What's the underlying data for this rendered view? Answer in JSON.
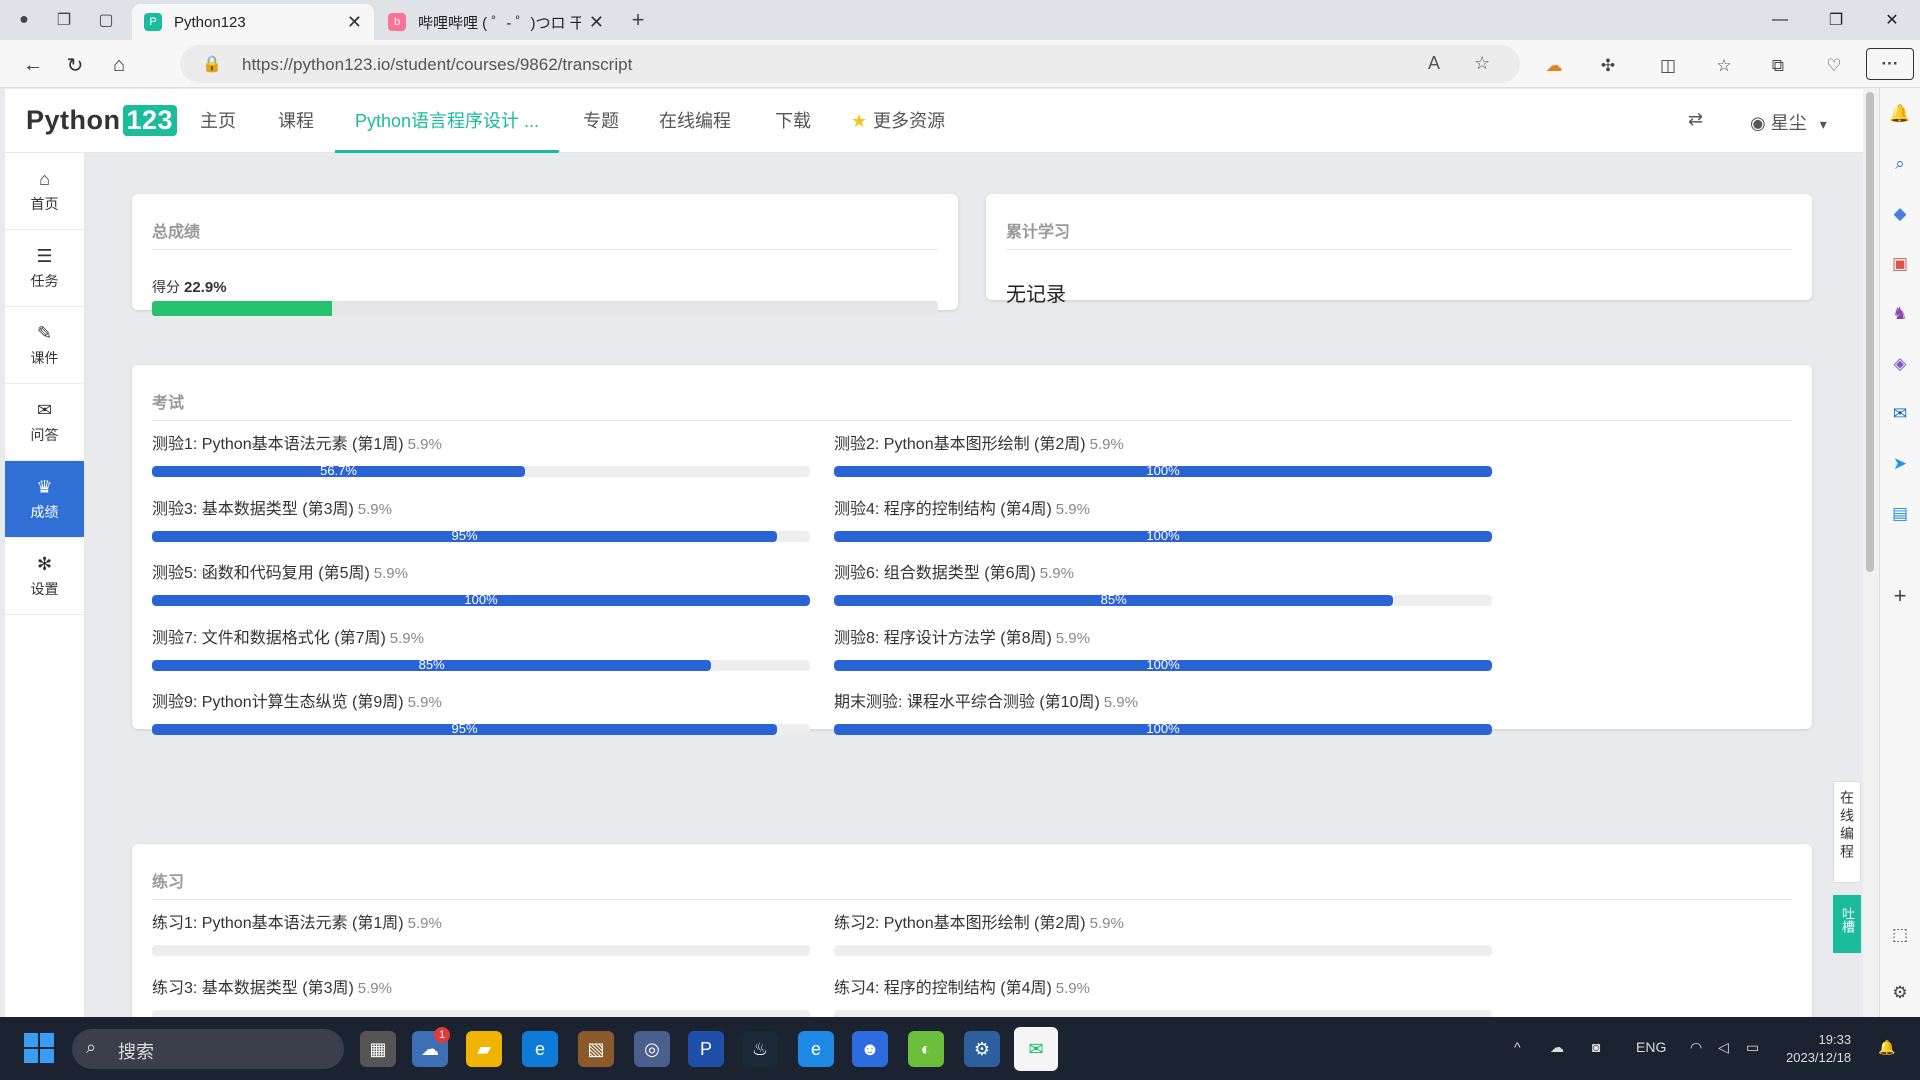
{
  "browser": {
    "tabs": [
      {
        "title": "Python123",
        "active": true
      },
      {
        "title": "哔哩哔哩 ( ゜- ゜)つロ 干杯~-bilib",
        "active": false
      }
    ],
    "new_tab": "+",
    "url": "https://python123.io/student/courses/9862/transcript",
    "menu_dots": "···"
  },
  "site": {
    "logo_text": "Python",
    "logo_num": "123",
    "menu": [
      {
        "label": "主页"
      },
      {
        "label": "课程"
      },
      {
        "label": "Python语言程序设计 ...",
        "active": true
      },
      {
        "label": "专题"
      },
      {
        "label": "在线编程"
      },
      {
        "label": "下载"
      },
      {
        "label": "更多资源"
      }
    ],
    "user_name": "星尘"
  },
  "sidebar": {
    "items": [
      {
        "label": "首页",
        "icon": "home-icon",
        "glyph": "⌂"
      },
      {
        "label": "任务",
        "icon": "tasks-icon",
        "glyph": "☰"
      },
      {
        "label": "课件",
        "icon": "paperclip-icon",
        "glyph": "✎"
      },
      {
        "label": "问答",
        "icon": "comments-icon",
        "glyph": "✉"
      },
      {
        "label": "成绩",
        "icon": "trophy-icon",
        "glyph": "♛",
        "active": true
      },
      {
        "label": "设置",
        "icon": "gear-icon",
        "glyph": "✻"
      }
    ]
  },
  "total": {
    "title": "总成绩",
    "score_label": "得分",
    "score_value": "22.9%",
    "score_fraction": 0.229
  },
  "cumulative": {
    "title": "累计学习",
    "value": "无记录"
  },
  "exams": {
    "title": "考试",
    "items": [
      {
        "name": "测验1: Python基本语法元素 (第1周)",
        "weight": "5.9%",
        "progress": "56.7%",
        "fraction": 0.567
      },
      {
        "name": "测验2: Python基本图形绘制 (第2周)",
        "weight": "5.9%",
        "progress": "100%",
        "fraction": 1.0
      },
      {
        "name": "测验3: 基本数据类型 (第3周)",
        "weight": "5.9%",
        "progress": "95%",
        "fraction": 0.95
      },
      {
        "name": "测验4: 程序的控制结构 (第4周)",
        "weight": "5.9%",
        "progress": "100%",
        "fraction": 1.0
      },
      {
        "name": "测验5: 函数和代码复用 (第5周)",
        "weight": "5.9%",
        "progress": "100%",
        "fraction": 1.0
      },
      {
        "name": "测验6: 组合数据类型 (第6周)",
        "weight": "5.9%",
        "progress": "85%",
        "fraction": 0.85
      },
      {
        "name": "测验7: 文件和数据格式化 (第7周)",
        "weight": "5.9%",
        "progress": "85%",
        "fraction": 0.85
      },
      {
        "name": "测验8: 程序设计方法学 (第8周)",
        "weight": "5.9%",
        "progress": "100%",
        "fraction": 1.0
      },
      {
        "name": "测验9: Python计算生态纵览 (第9周)",
        "weight": "5.9%",
        "progress": "95%",
        "fraction": 0.95
      },
      {
        "name": "期末测验: 课程水平综合测验 (第10周)",
        "weight": "5.9%",
        "progress": "100%",
        "fraction": 1.0
      }
    ]
  },
  "practice": {
    "title": "练习",
    "items": [
      {
        "name": "练习1: Python基本语法元素 (第1周)",
        "weight": "5.9%",
        "progress": "",
        "fraction": 0
      },
      {
        "name": "练习2: Python基本图形绘制 (第2周)",
        "weight": "5.9%",
        "progress": "",
        "fraction": 0
      },
      {
        "name": "练习3: 基本数据类型 (第3周)",
        "weight": "5.9%",
        "progress": "",
        "fraction": 0
      },
      {
        "name": "练习4: 程序的控制结构 (第4周)",
        "weight": "5.9%",
        "progress": "",
        "fraction": 0
      }
    ]
  },
  "float": {
    "online_code": "在线编程",
    "feedback": "吐槽"
  },
  "taskbar": {
    "search_placeholder": "搜索",
    "badge": "1",
    "lang": "ENG",
    "time": "19:33",
    "date": "2023/12/18"
  },
  "colors": {
    "accent": "#1abc9c",
    "progress_blue": "#2a63d4",
    "score_green": "#25c26d",
    "sidebar_active": "#2f6fd6"
  }
}
